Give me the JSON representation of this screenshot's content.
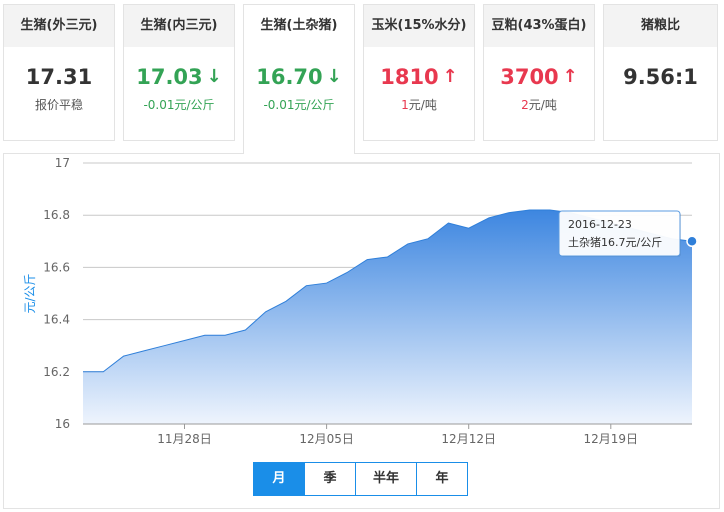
{
  "cards": [
    {
      "title": "生猪(外三元)",
      "price": "17.31",
      "arrow": "",
      "trend": "flat",
      "change": "报价平稳",
      "unit": ""
    },
    {
      "title": "生猪(内三元)",
      "price": "17.03",
      "arrow": "↓",
      "trend": "down",
      "change": "-0.01",
      "unit": "元/公斤"
    },
    {
      "title": "生猪(土杂猪)",
      "price": "16.70",
      "arrow": "↓",
      "trend": "down",
      "change": "-0.01",
      "unit": "元/公斤"
    },
    {
      "title": "玉米(15%水分)",
      "price": "1810",
      "arrow": "↑",
      "trend": "up",
      "change": "1",
      "unit": "元/吨"
    },
    {
      "title": "豆粕(43%蛋白)",
      "price": "3700",
      "arrow": "↑",
      "trend": "up",
      "change": "2",
      "unit": "元/吨"
    },
    {
      "title": "猪粮比",
      "price": "9.56:1",
      "arrow": "",
      "trend": "flat",
      "change": "",
      "unit": ""
    }
  ],
  "tabs": [
    "月",
    "季",
    "半年",
    "年"
  ],
  "active_tab": "月",
  "colors": {
    "accent": "#1a8ee8",
    "down": "#33a355",
    "up": "#e8384f",
    "area_top": "#3d86e0",
    "area_bottom": "#eef4fd",
    "grid": "#c8c8c8"
  },
  "chart_data": {
    "type": "area",
    "ylabel": "元/公斤",
    "ylim": [
      16,
      17
    ],
    "yticks": [
      "16",
      "16.2",
      "16.4",
      "16.6",
      "16.8",
      "17"
    ],
    "xticks": [
      "11月28日",
      "12月05日",
      "12月12日",
      "12月19日"
    ],
    "grid": true,
    "series": [
      {
        "name": "土杂猪",
        "x": [
          "2016-11-23",
          "2016-11-24",
          "2016-11-25",
          "2016-11-26",
          "2016-11-27",
          "2016-11-28",
          "2016-11-29",
          "2016-11-30",
          "2016-12-01",
          "2016-12-02",
          "2016-12-03",
          "2016-12-04",
          "2016-12-05",
          "2016-12-06",
          "2016-12-07",
          "2016-12-08",
          "2016-12-09",
          "2016-12-10",
          "2016-12-11",
          "2016-12-12",
          "2016-12-13",
          "2016-12-14",
          "2016-12-15",
          "2016-12-16",
          "2016-12-17",
          "2016-12-18",
          "2016-12-19",
          "2016-12-20",
          "2016-12-21",
          "2016-12-22",
          "2016-12-23"
        ],
        "values": [
          16.2,
          16.2,
          16.26,
          16.28,
          16.3,
          16.32,
          16.34,
          16.34,
          16.36,
          16.43,
          16.47,
          16.53,
          16.54,
          16.58,
          16.63,
          16.64,
          16.69,
          16.71,
          16.77,
          16.75,
          16.79,
          16.81,
          16.82,
          16.82,
          16.81,
          16.79,
          16.77,
          16.75,
          16.73,
          16.71,
          16.7
        ]
      }
    ],
    "tooltip": {
      "date": "2016-12-23",
      "label": "土杂猪16.7元/公斤"
    }
  }
}
